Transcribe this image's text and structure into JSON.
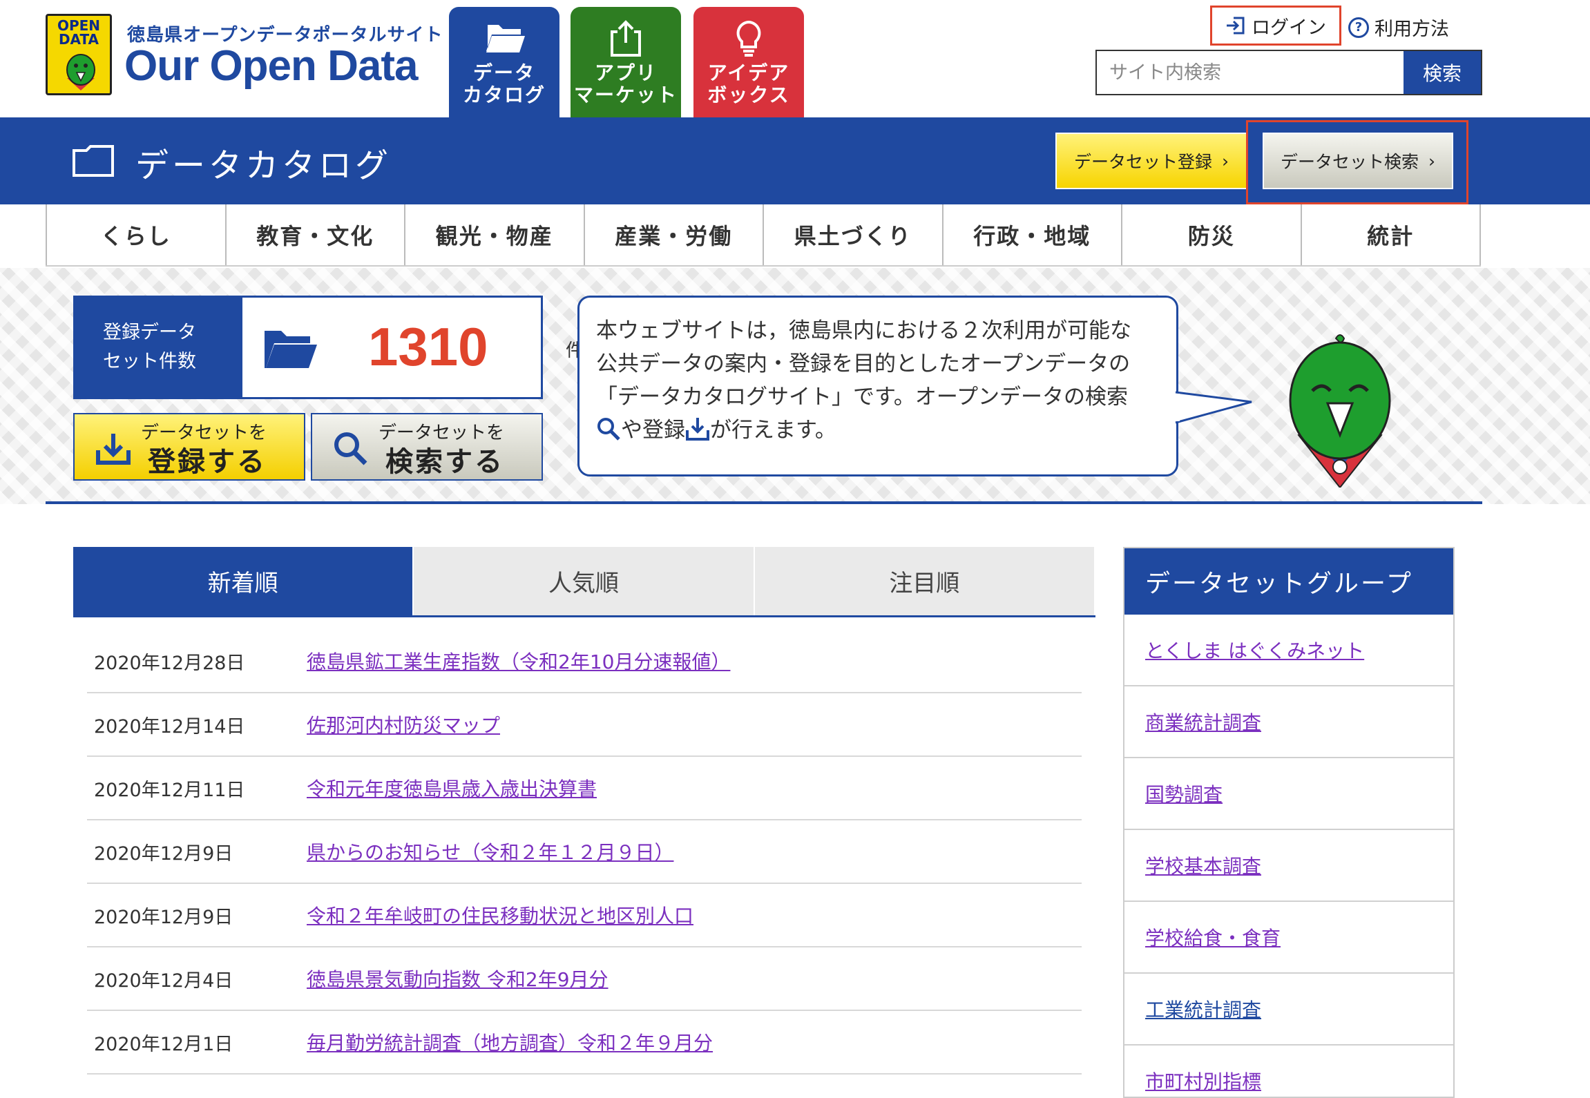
{
  "header": {
    "site_subtitle": "徳島県オープンデータポータルサイト",
    "site_title": "Our Open Data",
    "logo_badge_text": "OPEN DATA",
    "main_tabs": [
      {
        "label": "データ\nカタログ",
        "icon": "folder-open-icon",
        "color": "#1f49a0"
      },
      {
        "label": "アプリ\nマーケット",
        "icon": "share-upload-icon",
        "color": "#2e7d22"
      },
      {
        "label": "アイデア\nボックス",
        "icon": "lightbulb-icon",
        "color": "#d8323c"
      }
    ],
    "login_label": "ログイン",
    "howto_label": "利用方法",
    "search_placeholder": "サイト内検索",
    "search_button": "検索"
  },
  "band": {
    "title": "データカタログ",
    "register_button": "データセット登録",
    "search_button": "データセット検索"
  },
  "categories": [
    "くらし",
    "教育・文化",
    "観光・物産",
    "産業・労働",
    "県土づくり",
    "行政・地域",
    "防災",
    "統計"
  ],
  "hero": {
    "count_label": "登録データ\nセット件数",
    "count_value": "1310",
    "count_unit": "件",
    "register_small": "データセットを",
    "register_big": "登録する",
    "search_small": "データセットを",
    "search_big": "検索する",
    "bubble_line1": "本ウェブサイトは，徳島県内における２次利用が可能な",
    "bubble_line2": "公共データの案内・登録を目的としたオープンデータの",
    "bubble_line3": "「データカタログサイト」です。オープンデータの検索",
    "bubble_line4_a": "や登録",
    "bubble_line4_b": "が行えます。"
  },
  "tabs": [
    {
      "label": "新着順",
      "active": true
    },
    {
      "label": "人気順",
      "active": false
    },
    {
      "label": "注目順",
      "active": false
    }
  ],
  "news": [
    {
      "date": "2020年12月28日",
      "title": "徳島県鉱工業生産指数（令和2年10月分速報値）"
    },
    {
      "date": "2020年12月14日",
      "title": "佐那河内村防災マップ"
    },
    {
      "date": "2020年12月11日",
      "title": "令和元年度徳島県歳入歳出決算書"
    },
    {
      "date": "2020年12月9日",
      "title": "県からのお知らせ（令和２年１２月９日）"
    },
    {
      "date": "2020年12月9日",
      "title": "令和２年牟岐町の住民移動状況と地区別人口"
    },
    {
      "date": "2020年12月4日",
      "title": "徳島県景気動向指数 令和2年9月分"
    },
    {
      "date": "2020年12月1日",
      "title": "毎月勤労統計調査（地方調査）令和２年９月分"
    }
  ],
  "sidebar": {
    "title": "データセットグループ",
    "items": [
      {
        "label": "とくしま はぐくみネット",
        "visited": false
      },
      {
        "label": "商業統計調査",
        "visited": false
      },
      {
        "label": "国勢調査",
        "visited": false
      },
      {
        "label": "学校基本調査",
        "visited": false
      },
      {
        "label": "学校給食・食育",
        "visited": false
      },
      {
        "label": "工業統計調査",
        "visited": true
      },
      {
        "label": "市町村別指標",
        "visited": false
      }
    ]
  },
  "colors": {
    "primary": "#1f49a0",
    "accent_red": "#e0442c",
    "link": "#7b2fbf"
  }
}
